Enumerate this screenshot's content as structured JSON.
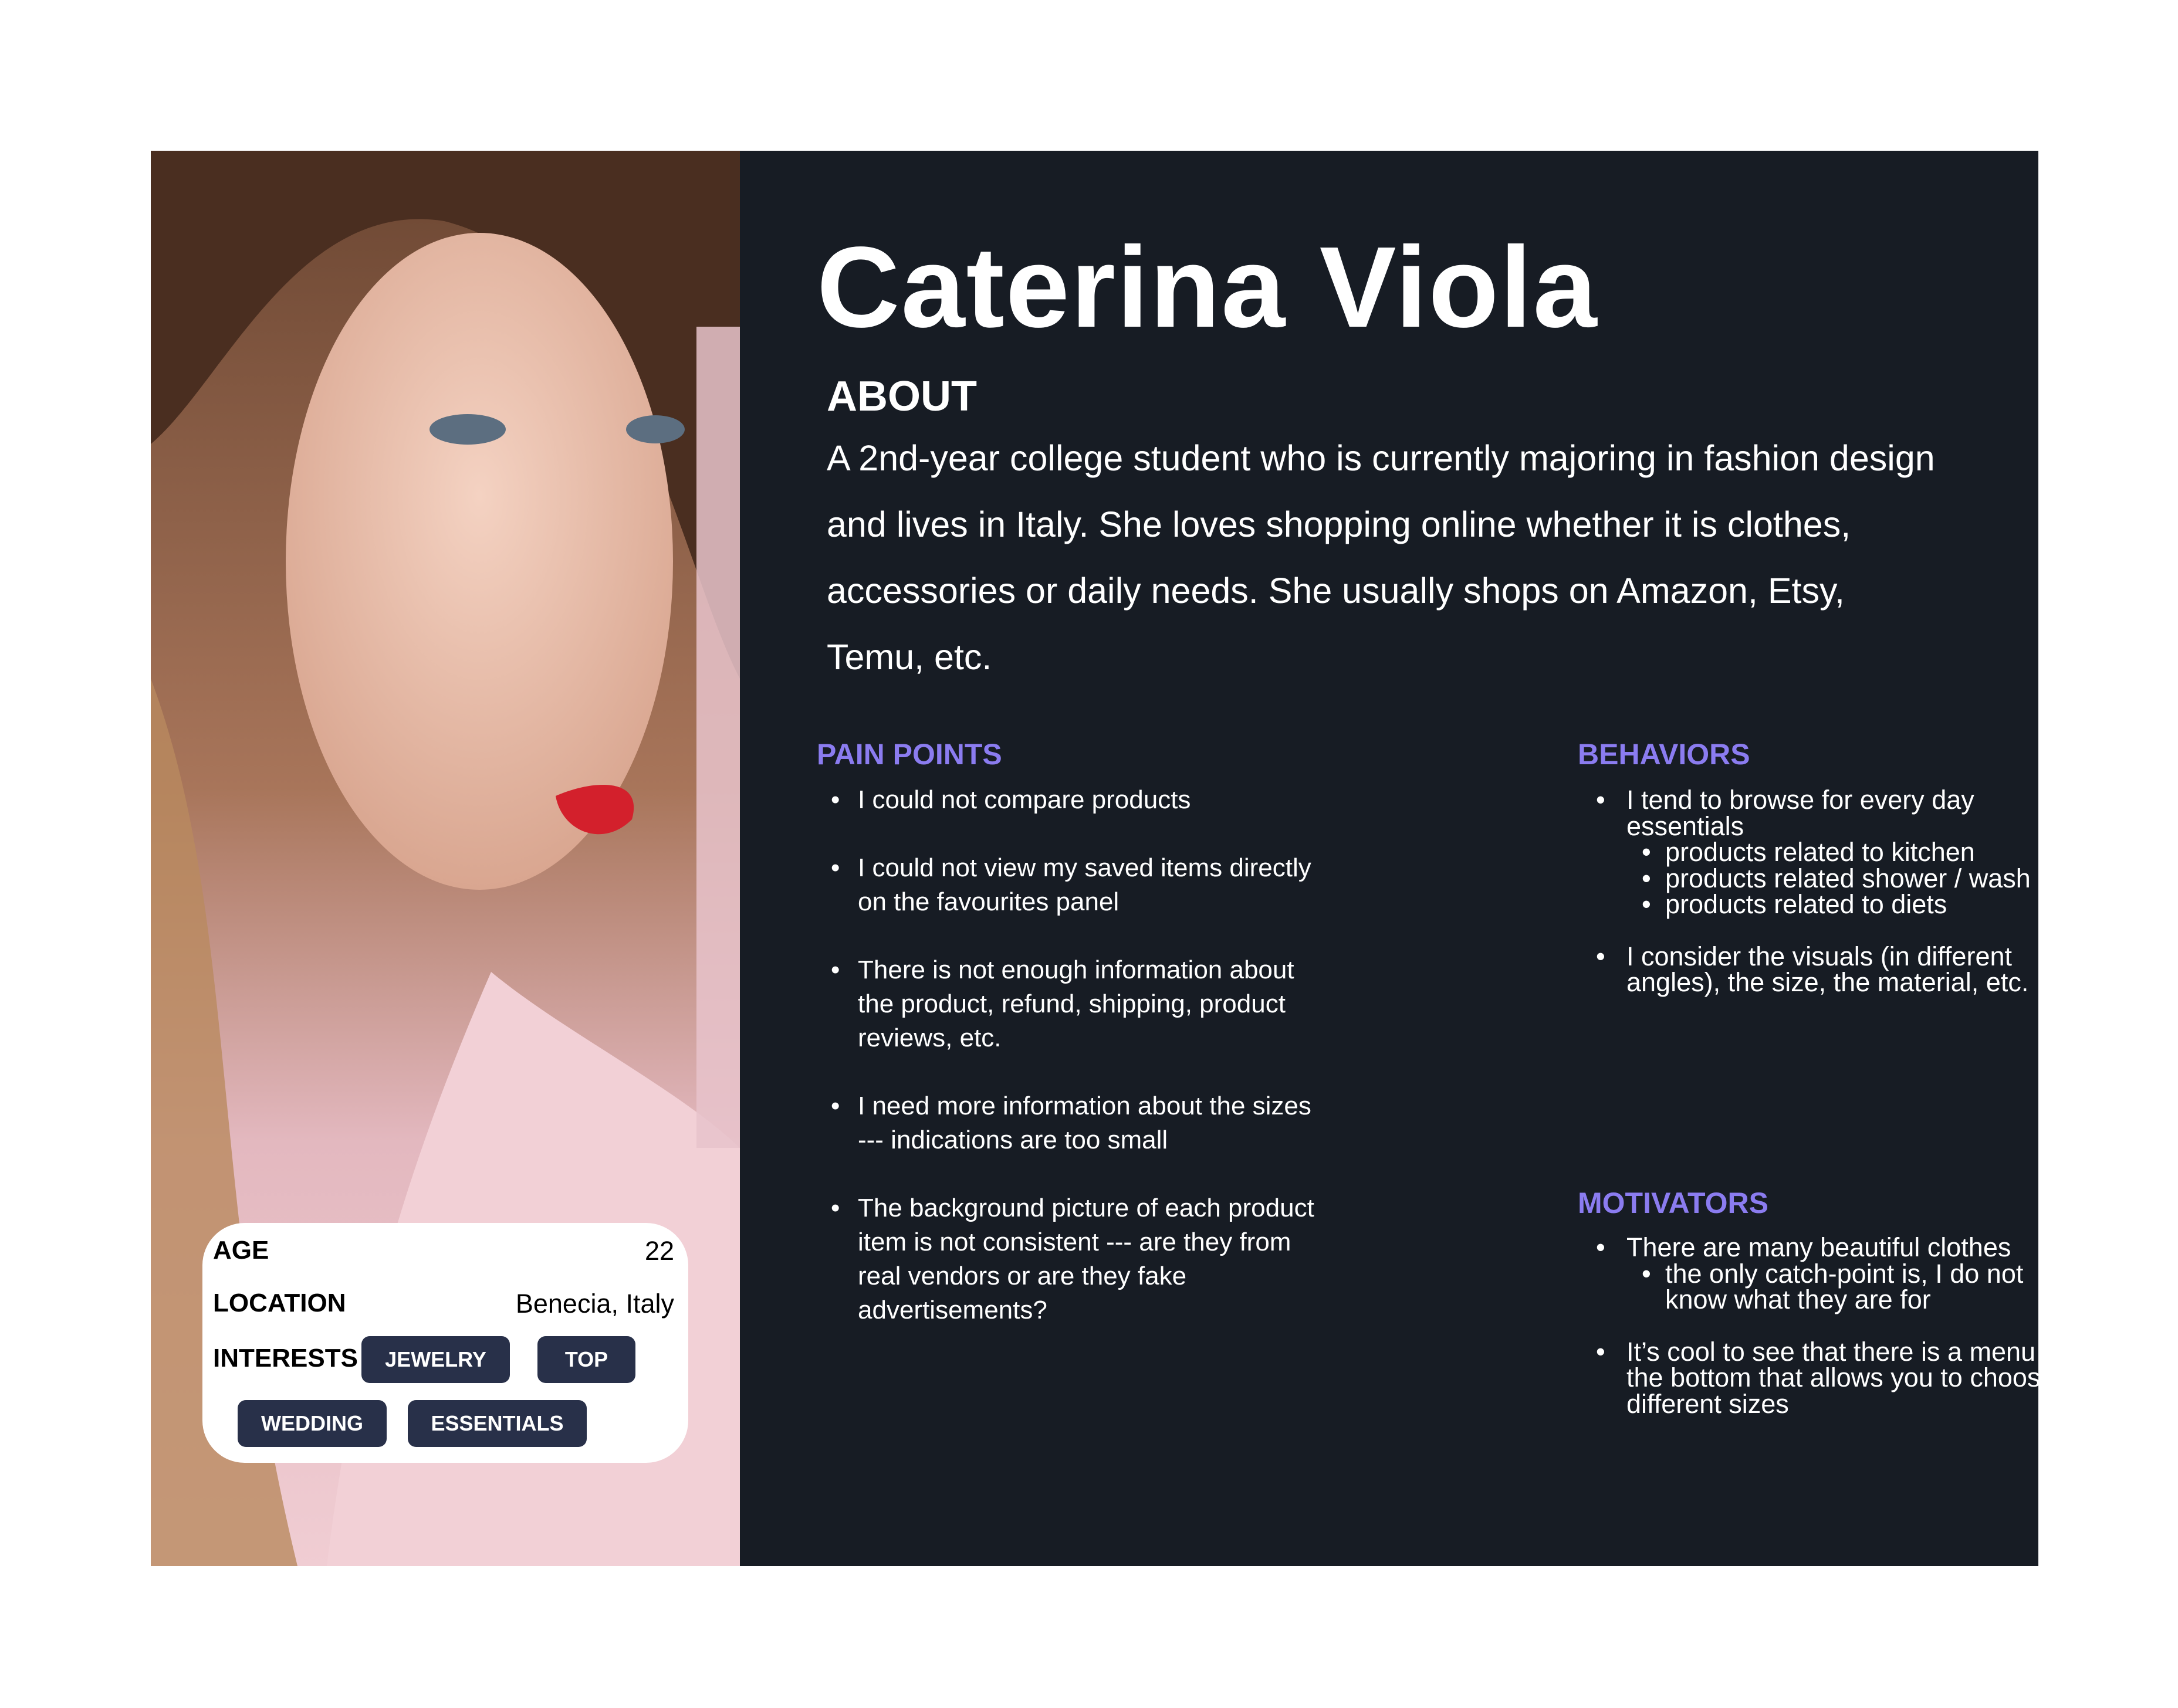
{
  "persona": {
    "name": "Caterina Viola",
    "about_heading": "ABOUT",
    "about_text": "A 2nd-year college student who is currently majoring in fashion design and lives in Italy. She loves shopping online whether it is clothes, accessories or daily needs. She usually shops on Amazon, Etsy, Temu, etc."
  },
  "info_card": {
    "age_label": "AGE",
    "age_value": "22",
    "location_label": "LOCATION",
    "location_value": "Benecia, Italy",
    "interests_label": "INTERESTS",
    "interests": [
      "JEWELRY",
      "TOP",
      "WEDDING",
      "ESSENTIALS"
    ]
  },
  "pain_points": {
    "heading": "PAIN POINTS",
    "items": [
      "I could not compare products",
      "I could not view my saved items directly on the favourites panel",
      "There is not enough information about the product, refund, shipping, product reviews, etc.",
      "I need more information about the sizes --- indications are too small",
      "The background picture of each product item is not consistent --- are they from real vendors or are they fake advertisements?"
    ]
  },
  "behaviors": {
    "heading": "BEHAVIORS",
    "items": [
      {
        "text": "I tend to browse for every day essentials",
        "sub": [
          "products related to kitchen",
          "products related shower / wash",
          "products related to diets"
        ]
      },
      {
        "text": "I consider the visuals (in different angles), the size, the material, etc."
      }
    ]
  },
  "motivators": {
    "heading": "MOTIVATORS",
    "items": [
      {
        "text": "There are many beautiful clothes",
        "sub": [
          "the only catch-point is, I do not know what they are for"
        ]
      },
      {
        "text": "It’s cool to see that there is a menu at the bottom that allows you to choose different sizes"
      }
    ]
  },
  "colors": {
    "panel": "#171c24",
    "accent": "#8b7cf0",
    "pill": "#283049"
  }
}
